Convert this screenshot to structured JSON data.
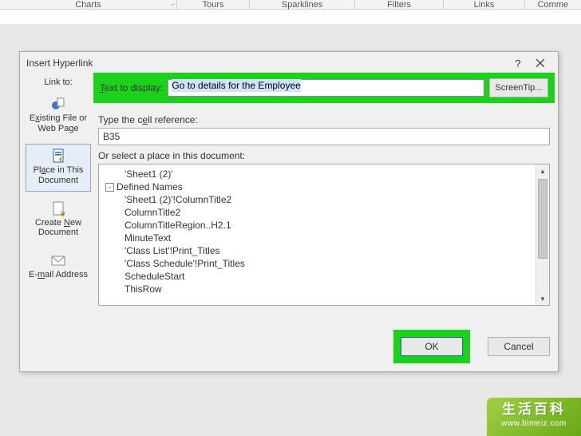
{
  "ribbon": {
    "groups": [
      "Charts",
      "Tours",
      "Sparklines",
      "Filters",
      "Links",
      "Comme"
    ]
  },
  "dialog": {
    "title": "Insert Hyperlink",
    "help": "?",
    "linkto_label": "Link to:",
    "linkto_items": [
      {
        "id": "existing",
        "label_html": "E<u>x</u>isting File or Web Page",
        "selected": false
      },
      {
        "id": "place",
        "label_html": "Pl<u>a</u>ce in This Document",
        "selected": true
      },
      {
        "id": "new",
        "label_html": "Create <u>N</u>ew Document",
        "selected": false
      },
      {
        "id": "email",
        "label_html": "E-<u>m</u>ail Address",
        "selected": false
      }
    ],
    "text_to_display_label_html": "<u>T</u>ext to display:",
    "text_to_display_value": "Go to details for the Employee",
    "screentip_label": "ScreenTip...",
    "cellref_label_html": "Type the c<u>e</u>ll reference:",
    "cellref_value": "B35",
    "place_label": "Or select a place in this document:",
    "tree": [
      {
        "level": 1,
        "text": "'Sheet1 (2)'"
      },
      {
        "level": 0,
        "text": "Defined Names",
        "expander": "-"
      },
      {
        "level": 1,
        "text": "'Sheet1 (2)'!ColumnTitle2"
      },
      {
        "level": 1,
        "text": "ColumnTitle2"
      },
      {
        "level": 1,
        "text": "ColumnTitleRegion..H2.1"
      },
      {
        "level": 1,
        "text": "MinuteText"
      },
      {
        "level": 1,
        "text": "'Class List'!Print_Titles"
      },
      {
        "level": 1,
        "text": "'Class Schedule'!Print_Titles"
      },
      {
        "level": 1,
        "text": "ScheduleStart"
      },
      {
        "level": 1,
        "text": "ThisRow"
      }
    ],
    "ok_label": "OK",
    "cancel_label": "Cancel"
  },
  "watermark": {
    "line1": "生活百科",
    "line2": "www.bimeiz.com"
  }
}
